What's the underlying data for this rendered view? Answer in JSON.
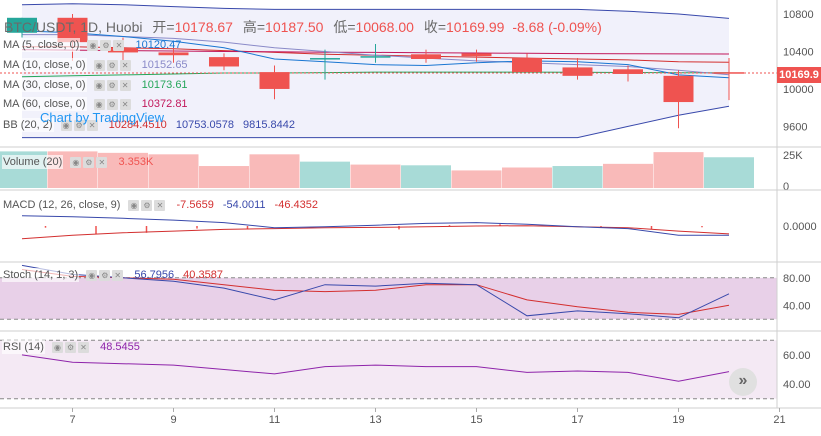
{
  "header": {
    "symbol": "BTC/USDT, 1D, Huobi",
    "open_label": "开=",
    "open": "10178.67",
    "high_label": "高=",
    "high": "10187.50",
    "low_label": "低=",
    "low": "10068.00",
    "close_label": "收=",
    "close": "10169.99",
    "change": "-8.68 (-0.09%)"
  },
  "watermark": "Chart by TradingView",
  "last_price_tag": "10169.9",
  "legends": {
    "ma5": {
      "label": "MA (5, close, 0)",
      "value": "10120.47",
      "color": "#1976d2"
    },
    "ma10": {
      "label": "MA (10, close, 0)",
      "value": "10152.65",
      "color": "#8a8ac8"
    },
    "ma30": {
      "label": "MA (30, close, 0)",
      "value": "10173.61",
      "color": "#26a65b"
    },
    "ma60": {
      "label": "MA (60, close, 0)",
      "value": "10372.81",
      "color": "#c2185b"
    },
    "bb": {
      "label": "BB (20, 2)",
      "v1": "10284.4510",
      "v2": "10753.0578",
      "v3": "9815.8442",
      "c1": "#d32f2f",
      "c2": "#3949ab",
      "c3": "#3949ab"
    },
    "volume": {
      "label": "Volume (20)",
      "value": "3.353K",
      "color": "#ef5350"
    },
    "macd": {
      "label": "MACD (12, 26, close, 9)",
      "v1": "-7.5659",
      "v2": "-54.0011",
      "v3": "-46.4352",
      "c1": "#d32f2f",
      "c2": "#3949ab",
      "c3": "#d32f2f"
    },
    "stoch": {
      "label": "Stoch (14, 1, 3)",
      "v1": "56.7956",
      "v2": "40.3587",
      "c1": "#3949ab",
      "c2": "#d32f2f"
    },
    "rsi": {
      "label": "RSI (14)",
      "value": "48.5455",
      "color": "#8e24aa"
    }
  },
  "scroll_icon": "double-chevron-right-icon",
  "chart_data": [
    {
      "type": "candlestick",
      "title": "BTC/USDT, 1D, Huobi",
      "x": [
        "6",
        "7",
        "8",
        "9",
        "10",
        "11",
        "12",
        "13",
        "14",
        "15",
        "16",
        "17",
        "18",
        "19",
        "20"
      ],
      "x_ticks": [
        "7",
        "9",
        "11",
        "13",
        "15",
        "17",
        "19",
        "21"
      ],
      "open": [
        10600,
        10760,
        10440,
        10390,
        10340,
        10180,
        10330,
        10340,
        10370,
        10380,
        10330,
        10230,
        10210,
        10140,
        10178.67
      ],
      "high": [
        10760,
        10800,
        10550,
        10450,
        10380,
        10250,
        10420,
        10480,
        10420,
        10420,
        10380,
        10330,
        10250,
        10200,
        10330
      ],
      "low": [
        10550,
        10300,
        10300,
        10280,
        10200,
        9890,
        10100,
        10280,
        10280,
        10290,
        10200,
        10100,
        10080,
        9580,
        9880
      ],
      "close": [
        10760,
        10500,
        10390,
        10360,
        10240,
        10000,
        10330,
        10350,
        10320,
        10350,
        10180,
        10140,
        10160,
        9860,
        10169.99
      ],
      "series": [
        {
          "name": "MA (5, close, 0)",
          "values": [
            10620,
            10600,
            10560,
            10510,
            10440,
            10320,
            10290,
            10260,
            10250,
            10280,
            10300,
            10290,
            10260,
            10150,
            10120.47
          ]
        },
        {
          "name": "MA (10, close, 0)",
          "values": [
            10580,
            10580,
            10560,
            10540,
            10500,
            10440,
            10400,
            10360,
            10330,
            10300,
            10280,
            10260,
            10240,
            10200,
            10152.65
          ]
        },
        {
          "name": "MA (30, close, 0)",
          "values": [
            10130,
            10140,
            10150,
            10160,
            10170,
            10170,
            10175,
            10180,
            10180,
            10180,
            10180,
            10178,
            10176,
            10174,
            10173.61
          ]
        },
        {
          "name": "MA (60, close, 0)",
          "values": [
            10420,
            10415,
            10410,
            10405,
            10400,
            10397,
            10393,
            10390,
            10387,
            10384,
            10381,
            10378,
            10376,
            10374,
            10372.81
          ]
        },
        {
          "name": "BB upper",
          "values": [
            10900,
            10910,
            10900,
            10880,
            10860,
            10850,
            10850,
            10850,
            10850,
            10850,
            10850,
            10850,
            10830,
            10800,
            10753.06
          ]
        },
        {
          "name": "BB basis",
          "values": [
            10450,
            10450,
            10440,
            10430,
            10410,
            10390,
            10370,
            10360,
            10350,
            10340,
            10330,
            10320,
            10310,
            10290,
            10284.45
          ]
        },
        {
          "name": "BB lower",
          "values": [
            9480,
            9480,
            9480,
            9480,
            9480,
            9480,
            9480,
            9480,
            9480,
            9480,
            9480,
            9480,
            9600,
            9720,
            9815.84
          ]
        }
      ],
      "y_ticks": [
        10800,
        10400,
        10000,
        9600
      ],
      "ylim": [
        9450,
        11000
      ]
    },
    {
      "type": "bar",
      "title": "Volume (20)",
      "x": [
        "6",
        "7",
        "8",
        "9",
        "10",
        "11",
        "12",
        "13",
        "14",
        "15",
        "16",
        "17",
        "18",
        "19",
        "20"
      ],
      "values": [
        25000,
        25000,
        24000,
        23000,
        15000,
        23000,
        18000,
        16000,
        15500,
        12000,
        14000,
        15000,
        16500,
        24500,
        21000
      ],
      "colors": [
        "up",
        "down",
        "down",
        "down",
        "down",
        "down",
        "up",
        "down",
        "up",
        "down",
        "down",
        "up",
        "down",
        "down",
        "up"
      ],
      "ma_values": [
        20000,
        20500,
        21000,
        21200,
        21000,
        20800,
        20500,
        20000,
        19500,
        19000,
        18500,
        18000,
        17800,
        18000,
        18200
      ],
      "y_ticks": [
        "25K",
        "0"
      ],
      "ylim": [
        0,
        28000
      ]
    },
    {
      "type": "line",
      "title": "MACD (12, 26, close, 9)",
      "x": [
        "6",
        "7",
        "8",
        "9",
        "10",
        "11",
        "12",
        "13",
        "14",
        "15",
        "16",
        "17",
        "18",
        "19",
        "20"
      ],
      "series": [
        {
          "name": "MACD",
          "values": [
            60,
            55,
            45,
            35,
            20,
            -10,
            -5,
            5,
            15,
            20,
            10,
            -5,
            -15,
            -55,
            -54.0011
          ]
        },
        {
          "name": "Signal",
          "values": [
            -75,
            -55,
            -40,
            -30,
            -20,
            -15,
            -10,
            -8,
            -5,
            0,
            2,
            -5,
            -10,
            -30,
            -46.4352
          ]
        },
        {
          "name": "Histogram",
          "values": [
            -60,
            -10,
            -50,
            -40,
            -15,
            -20,
            0,
            0,
            -20,
            5,
            10,
            0,
            -5,
            -20,
            -7.5659
          ]
        }
      ],
      "y_ticks": [
        "0.0000"
      ],
      "ylim": [
        -200,
        200
      ]
    },
    {
      "type": "line",
      "title": "Stoch (14, 1, 3)",
      "x": [
        "6",
        "7",
        "8",
        "9",
        "10",
        "11",
        "12",
        "13",
        "14",
        "15",
        "16",
        "17",
        "18",
        "19",
        "20"
      ],
      "series": [
        {
          "name": "%K",
          "values": [
            98,
            85,
            80,
            75,
            65,
            48,
            70,
            68,
            72,
            70,
            25,
            32,
            28,
            22,
            56.7956
          ]
        },
        {
          "name": "%D",
          "values": [
            92,
            82,
            80,
            78,
            70,
            62,
            60,
            62,
            70,
            70,
            48,
            38,
            30,
            27,
            40.3587
          ]
        }
      ],
      "bands": [
        80,
        20
      ],
      "y_ticks": [
        80.0,
        40.0
      ],
      "ylim": [
        0,
        100
      ]
    },
    {
      "type": "line",
      "title": "RSI (14)",
      "x": [
        "6",
        "7",
        "8",
        "9",
        "10",
        "11",
        "12",
        "13",
        "14",
        "15",
        "16",
        "17",
        "18",
        "19",
        "20"
      ],
      "series": [
        {
          "name": "RSI",
          "values": [
            60,
            55,
            54,
            53,
            50,
            47,
            52,
            53,
            52,
            52,
            48,
            49,
            48,
            42,
            48.5455
          ]
        }
      ],
      "bands": [
        70,
        30
      ],
      "y_ticks": [
        60.0,
        40.0
      ],
      "ylim": [
        25,
        75
      ]
    }
  ]
}
